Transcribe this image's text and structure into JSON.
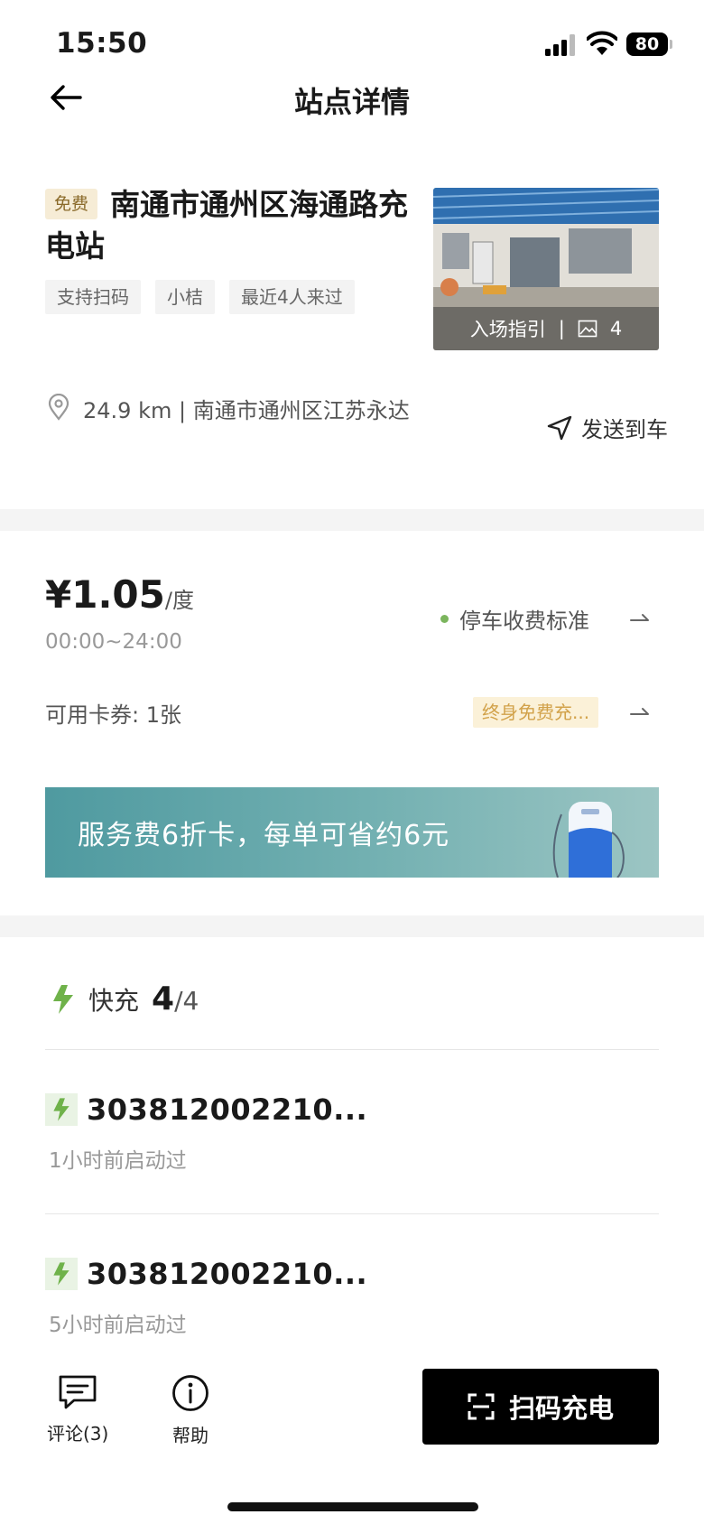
{
  "status_bar": {
    "time": "15:50",
    "battery": "80"
  },
  "nav": {
    "title": "站点详情"
  },
  "station": {
    "free_badge": "免费",
    "name": "南通市通州区海通路充电站",
    "tags": [
      "支持扫码",
      "小桔",
      "最近4人来过"
    ],
    "photo_guide": "入场指引",
    "photo_separator": "|",
    "photo_count": "4"
  },
  "address": {
    "distance": "24.9 km",
    "separator": "|",
    "text": "南通市通州区江苏永达",
    "send_to_car": "发送到车"
  },
  "price": {
    "value": "¥1.05",
    "unit": "/度",
    "hours": "00:00~24:00",
    "parking_label": "停车收费标准",
    "coupon_label": "可用卡券: 1张",
    "coupon_badge": "终身免费充..."
  },
  "banner": {
    "text": "服务费6折卡，每单可省约6元"
  },
  "fast_charge": {
    "label": "快充",
    "available": "4",
    "total": "/4"
  },
  "chargers": [
    {
      "id": "303812002210...",
      "meta": "1小时前启动过"
    },
    {
      "id": "303812002210...",
      "meta": "5小时前启动过"
    }
  ],
  "bottom": {
    "comments": "评论(3)",
    "help": "帮助",
    "scan": "扫码充电"
  },
  "colors": {
    "accent_green": "#7bb55d",
    "badge_gold": "#d2a24a",
    "primary_button": "#000000"
  }
}
